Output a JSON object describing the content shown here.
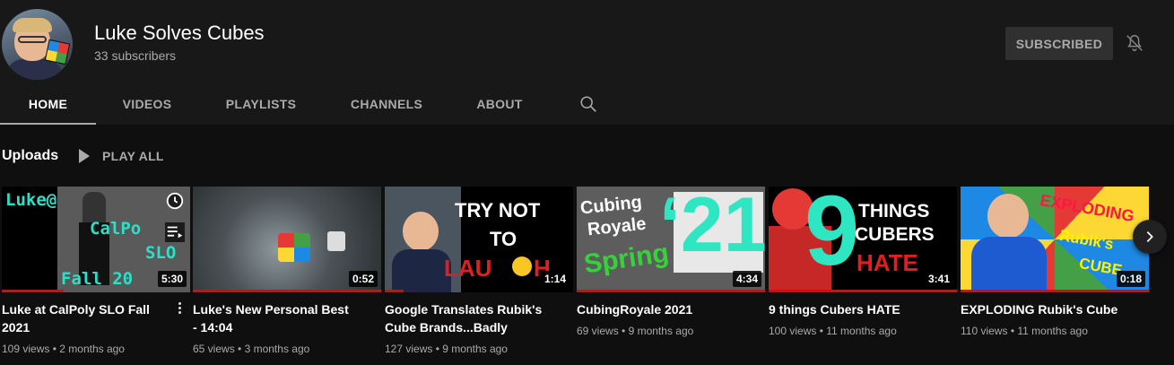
{
  "channel": {
    "name": "Luke Solves Cubes",
    "subscribers": "33 subscribers",
    "subscribe_label": "SUBSCRIBED"
  },
  "tabs": [
    {
      "label": "HOME",
      "active": true
    },
    {
      "label": "VIDEOS",
      "active": false
    },
    {
      "label": "PLAYLISTS",
      "active": false
    },
    {
      "label": "CHANNELS",
      "active": false
    },
    {
      "label": "ABOUT",
      "active": false
    }
  ],
  "uploads": {
    "title": "Uploads",
    "play_all": "PLAY ALL"
  },
  "videos": [
    {
      "title": "Luke at CalPoly SLO Fall 2021",
      "views": "109 views",
      "age": "2 months ago",
      "duration": "5:30",
      "watched_fraction": 0.33,
      "thumb_text": [
        "Luke@",
        "CalPo",
        "SLO",
        "Fall 20"
      ]
    },
    {
      "title": "Luke's New Personal Best - 14:04",
      "views": "65 views",
      "age": "3 months ago",
      "duration": "0:52",
      "watched_fraction": 1.0
    },
    {
      "title": "Google Translates Rubik's Cube Brands...Badly",
      "views": "127 views",
      "age": "9 months ago",
      "duration": "1:14",
      "watched_fraction": 0.1,
      "thumb_text": [
        "TRY NOT",
        "TO",
        "LAU",
        "H"
      ]
    },
    {
      "title": "CubingRoyale 2021",
      "views": "69 views",
      "age": "9 months ago",
      "duration": "4:34",
      "watched_fraction": 1.0,
      "thumb_text": [
        "Cubing",
        "Royale",
        "Spring",
        "‘21"
      ]
    },
    {
      "title": "9 things Cubers HATE",
      "views": "100 views",
      "age": "11 months ago",
      "duration": "3:41",
      "watched_fraction": 1.0,
      "thumb_text": [
        "9",
        "THINGS",
        "CUBERS",
        "HATE"
      ]
    },
    {
      "title": "EXPLODING Rubik's Cube",
      "views": "110 views",
      "age": "11 months ago",
      "duration": "0:18",
      "watched_fraction": 1.0,
      "thumb_text": [
        "EXPLODING",
        "Rubik's",
        "CUBE"
      ]
    }
  ],
  "meta_separator": "•",
  "colors": {
    "background": "#181818",
    "content_bg": "#0f0f0f",
    "progress": "#ee0000",
    "muted_text": "#aaaaaa"
  },
  "icons": [
    "bell-off-icon",
    "search-icon",
    "clock-icon",
    "add-to-queue-icon",
    "play-icon",
    "more-vert-icon",
    "chevron-right-icon"
  ]
}
